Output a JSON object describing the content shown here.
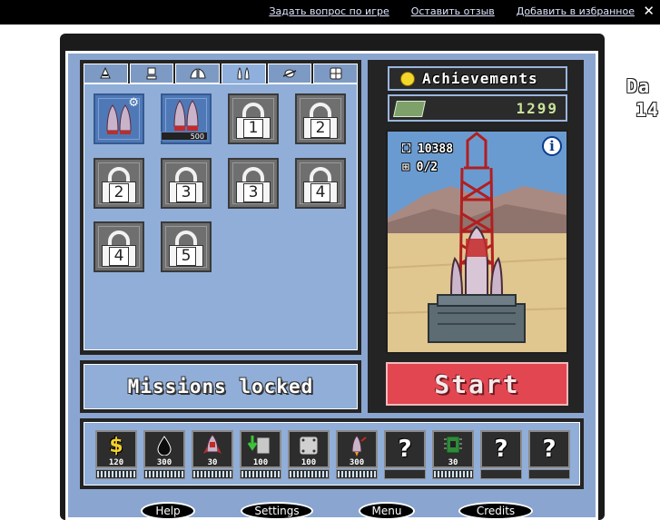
{
  "topbar": {
    "links": [
      "Задать вопрос по игре",
      "Оставить отзыв",
      "Добавить в избранное"
    ],
    "close": "✕"
  },
  "side": {
    "title_line1": "Da",
    "title_line2": "14"
  },
  "tabs": [
    "ship",
    "computer",
    "wings",
    "thrusters",
    "satellite",
    "modules"
  ],
  "inventory": {
    "owned": [
      {
        "name": "boosters-owned",
        "price": ""
      },
      {
        "name": "boosters-red",
        "price": "500"
      }
    ],
    "locked": [
      "1",
      "2",
      "2",
      "3",
      "3",
      "4",
      "4",
      "5"
    ]
  },
  "missions": {
    "label": "Missions locked"
  },
  "right": {
    "achievements_label": "Achievements",
    "money": "1299",
    "stat_height": "10388",
    "stat_parts": "0/2",
    "info": "i",
    "start_label": "Start"
  },
  "upgrades": [
    {
      "icon": "dollar",
      "value": "120",
      "fill": 1.0
    },
    {
      "icon": "oil",
      "value": "300",
      "fill": 1.0
    },
    {
      "icon": "rocket",
      "value": "30",
      "fill": 1.0
    },
    {
      "icon": "fuel-tank",
      "value": "100",
      "fill": 1.0
    },
    {
      "icon": "armor-plate",
      "value": "100",
      "fill": 1.0
    },
    {
      "icon": "missile",
      "value": "300",
      "fill": 1.0
    },
    {
      "icon": "unknown",
      "value": "",
      "fill": 0.0
    },
    {
      "icon": "circuit-board",
      "value": "30",
      "fill": 1.0
    },
    {
      "icon": "unknown",
      "value": "",
      "fill": 0.0
    },
    {
      "icon": "unknown",
      "value": "",
      "fill": 0.0
    }
  ],
  "bottom_buttons": [
    "Help",
    "Settings",
    "Menu",
    "Credits"
  ]
}
